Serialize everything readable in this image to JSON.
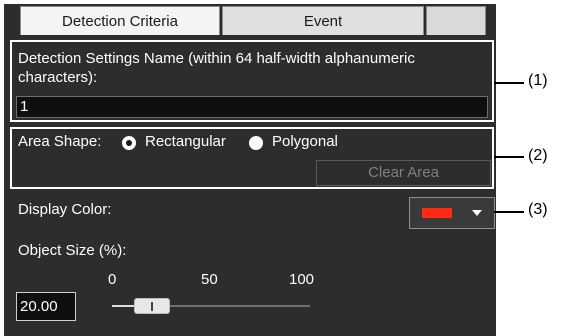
{
  "tabs": {
    "detection_criteria": "Detection Criteria",
    "event": "Event"
  },
  "detection_settings": {
    "label": "Detection Settings Name (within 64 half-width alphanumeric characters):",
    "value": "1"
  },
  "area_shape": {
    "label": "Area Shape:",
    "options": [
      "Rectangular",
      "Polygonal"
    ],
    "selected": "Rectangular",
    "clear_button": "Clear Area"
  },
  "display_color": {
    "label": "Display Color:",
    "swatch_color": "#ff2a12"
  },
  "object_size": {
    "label": "Object Size (%):",
    "value": "20.00",
    "slider_ticks": [
      "0",
      "50",
      "100"
    ],
    "slider_value_percent": 20
  },
  "callouts": [
    "(1)",
    "(2)",
    "(3)"
  ],
  "icons": {
    "dropdown": "chevron-down-icon",
    "radio": "radio-icon"
  }
}
